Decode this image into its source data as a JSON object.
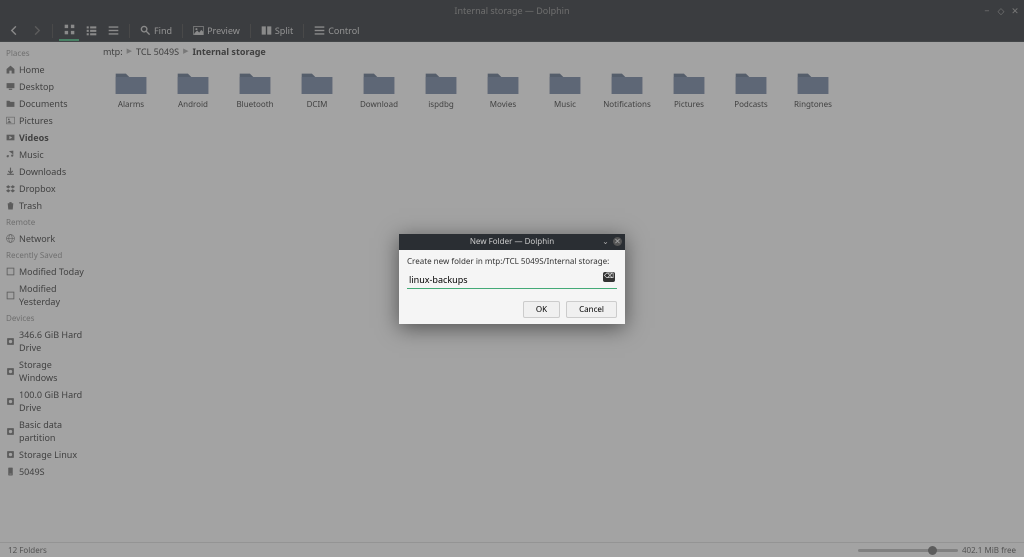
{
  "window": {
    "title": "Internal storage — Dolphin"
  },
  "toolbar": {
    "back": "Back",
    "forward": "Forward",
    "icons_view": "Icons",
    "compact_view": "Compact",
    "details_view": "Details",
    "find": "Find",
    "preview": "Preview",
    "split": "Split",
    "control": "Control"
  },
  "breadcrumb": {
    "root": "mtp:",
    "level1": "TCL 5049S",
    "current": "Internal storage"
  },
  "sidebar": {
    "places_header": "Places",
    "places": [
      {
        "label": "Home",
        "icon": "home"
      },
      {
        "label": "Desktop",
        "icon": "desktop"
      },
      {
        "label": "Documents",
        "icon": "folder"
      },
      {
        "label": "Pictures",
        "icon": "image"
      },
      {
        "label": "Videos",
        "icon": "video",
        "bold": true
      },
      {
        "label": "Music",
        "icon": "music"
      },
      {
        "label": "Downloads",
        "icon": "download"
      },
      {
        "label": "Dropbox",
        "icon": "dropbox"
      },
      {
        "label": "Trash",
        "icon": "trash"
      }
    ],
    "remote_header": "Remote",
    "remote": [
      {
        "label": "Network",
        "icon": "network"
      }
    ],
    "recent_header": "Recently Saved",
    "recent": [
      {
        "label": "Modified Today",
        "icon": "square"
      },
      {
        "label": "Modified Yesterday",
        "icon": "square"
      }
    ],
    "devices_header": "Devices",
    "devices": [
      {
        "label": "346.6 GiB Hard Drive",
        "icon": "disk"
      },
      {
        "label": "Storage Windows",
        "icon": "disk"
      },
      {
        "label": "100.0 GiB Hard Drive",
        "icon": "disk"
      },
      {
        "label": "Basic data partition",
        "icon": "disk"
      },
      {
        "label": "Storage Linux",
        "icon": "disk"
      },
      {
        "label": "5049S",
        "icon": "phone"
      }
    ]
  },
  "folders": [
    "Alarms",
    "Android",
    "Bluetooth",
    "DCIM",
    "Download",
    "ispdbg",
    "Movies",
    "Music",
    "Notifications",
    "Pictures",
    "Podcasts",
    "Ringtones"
  ],
  "statusbar": {
    "count": "12 Folders",
    "free": "402.1 MiB free"
  },
  "dialog": {
    "title": "New Folder — Dolphin",
    "label": "Create new folder in mtp:/TCL 5049S/Internal storage:",
    "input_value": "linux-backups",
    "ok": "OK",
    "cancel": "Cancel"
  }
}
